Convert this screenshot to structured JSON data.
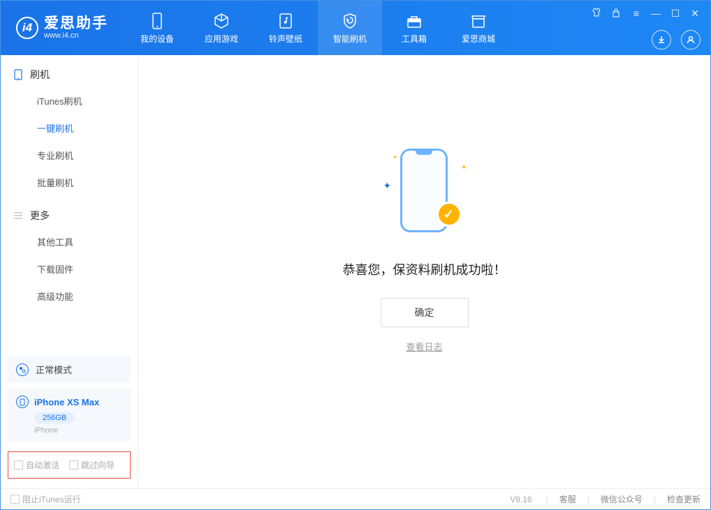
{
  "app": {
    "title": "爱思助手",
    "url": "www.i4.cn"
  },
  "nav": {
    "tabs": [
      {
        "label": "我的设备"
      },
      {
        "label": "应用游戏"
      },
      {
        "label": "铃声壁纸"
      },
      {
        "label": "智能刷机"
      },
      {
        "label": "工具箱"
      },
      {
        "label": "爱思商城"
      }
    ]
  },
  "sidebar": {
    "section1": {
      "title": "刷机",
      "items": [
        "iTunes刷机",
        "一键刷机",
        "专业刷机",
        "批量刷机"
      ]
    },
    "section2": {
      "title": "更多",
      "items": [
        "其他工具",
        "下载固件",
        "高级功能"
      ]
    }
  },
  "mode": {
    "label": "正常模式"
  },
  "device": {
    "name": "iPhone XS Max",
    "storage": "256GB",
    "type": "iPhone"
  },
  "checkboxes": {
    "auto_activate": "自动激活",
    "skip_guide": "跳过向导"
  },
  "main": {
    "success": "恭喜您，保资料刷机成功啦！",
    "ok": "确定",
    "view_log": "查看日志"
  },
  "footer": {
    "block_itunes": "阻止iTunes运行",
    "version": "V8.16",
    "links": [
      "客服",
      "微信公众号",
      "检查更新"
    ]
  }
}
